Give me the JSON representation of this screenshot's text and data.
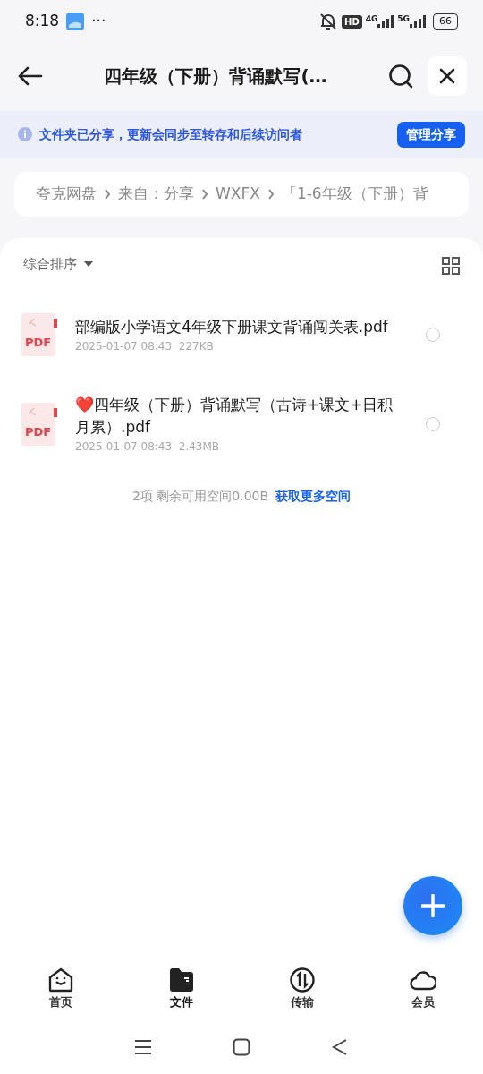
{
  "status_bar": {
    "time": "8:18",
    "more": "···",
    "hd": "HD",
    "net_1": "4G",
    "net_2": "5G",
    "battery": "66"
  },
  "header": {
    "title": "四年级（下册）背诵默写(…"
  },
  "banner": {
    "text": "文件夹已分享，更新会同步至转存和后续访问者",
    "button": "管理分享"
  },
  "breadcrumb": [
    "夸克网盘",
    "来自：分享",
    "WXFX",
    "「1-6年级（下册）背"
  ],
  "sort": {
    "label": "综合排序"
  },
  "files": [
    {
      "kind": "pdf",
      "badge": "PDF",
      "name": "部编版小学语文4年级下册课文背诵闯关表.pdf",
      "date": "2025-01-07 08:43",
      "size": "227KB",
      "selected": false
    },
    {
      "kind": "pdf",
      "badge": "PDF",
      "name": "❤️四年级（下册）背诵默写（古诗+课文+日积月累）.pdf",
      "date": "2025-01-07 08:43",
      "size": "2.43MB",
      "selected": false
    }
  ],
  "footer": {
    "count": "2项 剩余可用空间0.00B",
    "link": "获取更多空间"
  },
  "tabs": [
    {
      "kind": "home",
      "label": "首页",
      "selected": false
    },
    {
      "kind": "files",
      "label": "文件",
      "selected": true
    },
    {
      "kind": "transfer",
      "label": "传输",
      "selected": false
    },
    {
      "kind": "member",
      "label": "会员",
      "selected": false
    }
  ]
}
